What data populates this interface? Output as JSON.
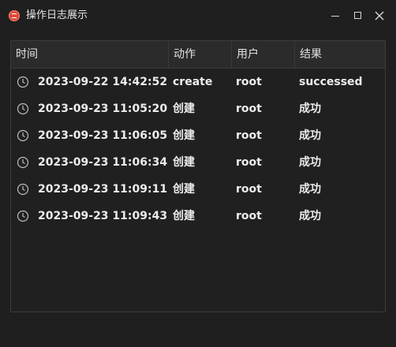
{
  "window": {
    "title": "操作日志展示",
    "controls": [
      "minimize-icon",
      "maximize-icon",
      "close-icon"
    ]
  },
  "table": {
    "columns": [
      "时间",
      "动作",
      "用户",
      "结果"
    ],
    "rows": [
      {
        "time": "2023-09-22 14:42:52",
        "action": "create",
        "user": "root",
        "result": "successed",
        "icon": "clock-icon"
      },
      {
        "time": "2023-09-23 11:05:20",
        "action": "创建",
        "user": "root",
        "result": "成功",
        "icon": "clock-icon"
      },
      {
        "time": "2023-09-23 11:06:05",
        "action": "创建",
        "user": "root",
        "result": "成功",
        "icon": "clock-icon"
      },
      {
        "time": "2023-09-23 11:06:34",
        "action": "创建",
        "user": "root",
        "result": "成功",
        "icon": "clock-icon"
      },
      {
        "time": "2023-09-23 11:09:11",
        "action": "创建",
        "user": "root",
        "result": "成功",
        "icon": "clock-icon"
      },
      {
        "time": "2023-09-23 11:09:43",
        "action": "创建",
        "user": "root",
        "result": "成功",
        "icon": "clock-icon"
      }
    ]
  },
  "colors": {
    "background": "#1f1f1f",
    "header": "#2b2b2b",
    "text": "#ececec",
    "app_icon": "#e04a3a"
  }
}
